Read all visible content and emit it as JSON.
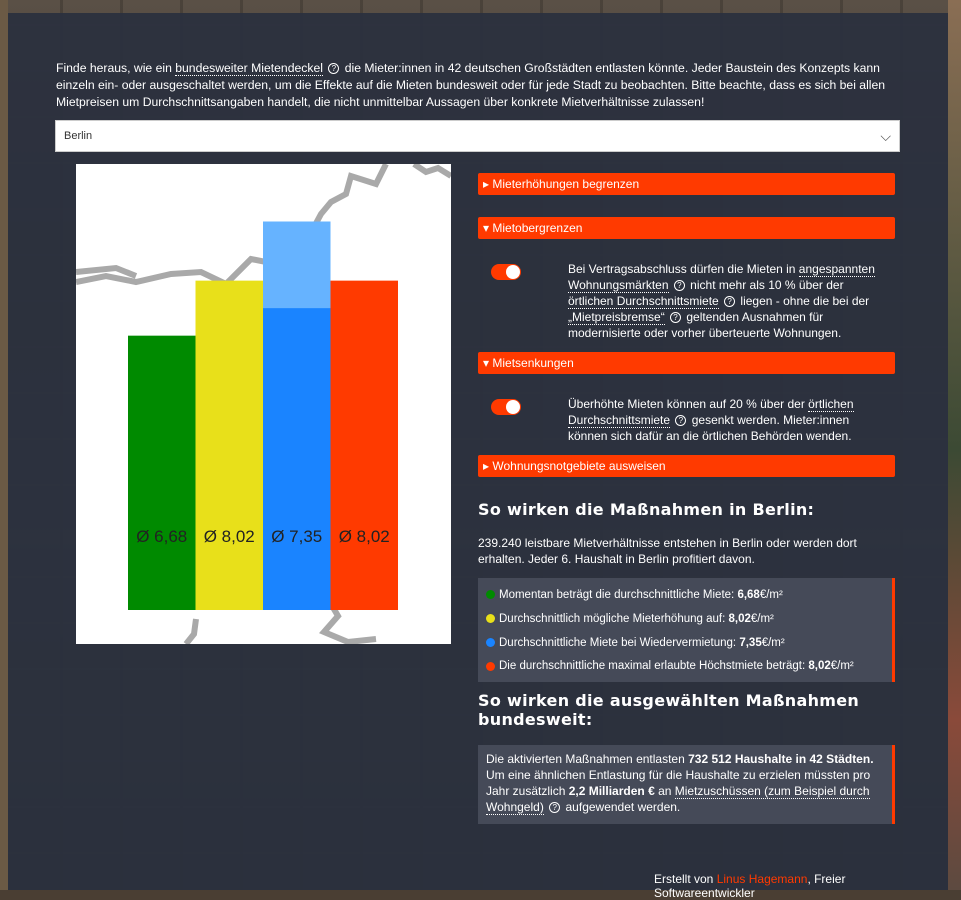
{
  "intro": {
    "part1": "Finde heraus, wie ein ",
    "link": "bundesweiter Mietendeckel",
    "part2": " die Mieter:innen in 42 deutschen Großstädten entlasten könnte. Jeder Baustein des Konzepts kann einzeln ein- oder ausgeschaltet werden, um die Effekte auf die Mieten bundesweit oder für jede Stadt zu beobachten. Bitte beachte, dass es sich bei allen Mietpreisen um Durchschnittsangaben handelt, die nicht unmittelbar Aussagen über konkrete Mietverhältnisse zulassen!",
    "help_glyph": "?"
  },
  "city_select": {
    "value": "Berlin",
    "chevron": "⌵"
  },
  "chart_data": {
    "type": "bar",
    "categories": [
      "Momentan",
      "Mieterhöhung",
      "Wiedervermietung",
      "Höchstmiete"
    ],
    "values": [
      6.68,
      8.02,
      7.35,
      8.02
    ],
    "extra_segment": {
      "category": "Wiedervermietung",
      "value": 9.46,
      "color": "#66b3ff"
    },
    "labels": [
      "Ø 6,68",
      "Ø 8,02",
      "Ø 7,35",
      "Ø 8,02"
    ],
    "colors": [
      "#008a00",
      "#e8e01a",
      "#1a84ff",
      "#ff3a00"
    ],
    "ylim": [
      0,
      10.86
    ]
  },
  "accordions": [
    {
      "label": "▸ Mieterhöhungen begrenzen"
    },
    {
      "label": "▾ Mietobergrenzen"
    },
    {
      "label": "▾ Mietsenkungen"
    },
    {
      "label": "▸ Wohnungsnotgebiete ausweisen"
    }
  ],
  "mietobergrenzen": {
    "text1": "Bei Vertragsabschluss dürfen die Mieten in ",
    "link1": "angespannten Wohnungsmärkten",
    "text2": " nicht mehr als 10 % über der ",
    "link2": "örtlichen Durchschnittsmiete",
    "text3": " liegen - ohne die bei der ",
    "link3": "„Mietpreisbremse“",
    "text4": " geltenden Ausnahmen für modernisierte oder vorher überteuerte Wohnungen."
  },
  "mietsenkungen": {
    "text1": "Überhöhte Mieten können auf 20 % über der ",
    "link1": "örtlichen Durchschnittsmiete",
    "text2": " gesenkt werden. Mieter:innen können sich dafür an die örtlichen Behörden wenden."
  },
  "city_heading": "So wirken die Maßnahmen in Berlin:",
  "city_text": "239.240 leistbare Mietverhältnisse entstehen in Berlin oder werden dort erhalten. Jeder 6. Haushalt in Berlin profitiert davon.",
  "legend_rows": [
    {
      "text": "Momentan beträgt die durchschnittliche Miete: ",
      "value": "6,68",
      "unit": "€/m²"
    },
    {
      "text": "Durchschnittlich mögliche Mieterhöhung auf: ",
      "value": "8,02",
      "unit": "€/m²"
    },
    {
      "text": "Durchschnittliche Miete bei Wiedervermietung: ",
      "value": "7,35",
      "unit": "€/m²"
    },
    {
      "text": "Die durchschnittliche maximal erlaubte Höchstmiete beträgt: ",
      "value": "8,02",
      "unit": "€/m²"
    }
  ],
  "national_heading": "So wirken die ausgewählten Maßnahmen bundesweit:",
  "summary": {
    "t1": "Die aktivierten Maßnahmen entlasten ",
    "b1": "732 512 Haushalte in 42 Städten.",
    "t2": " Um eine ähnlichen Entlastung für die Haushalte zu erzielen müssten pro Jahr zusätzlich ",
    "b2": "2,2 Milliarden €",
    "t3": " an ",
    "link": "Mietzuschüssen (zum Beispiel durch Wohngeld)",
    "t4": " aufgewendet werden."
  },
  "footer": {
    "prefix": "Erstellt von ",
    "author": "Linus Hagemann",
    "suffix": ", Freier Softwareentwickler"
  }
}
